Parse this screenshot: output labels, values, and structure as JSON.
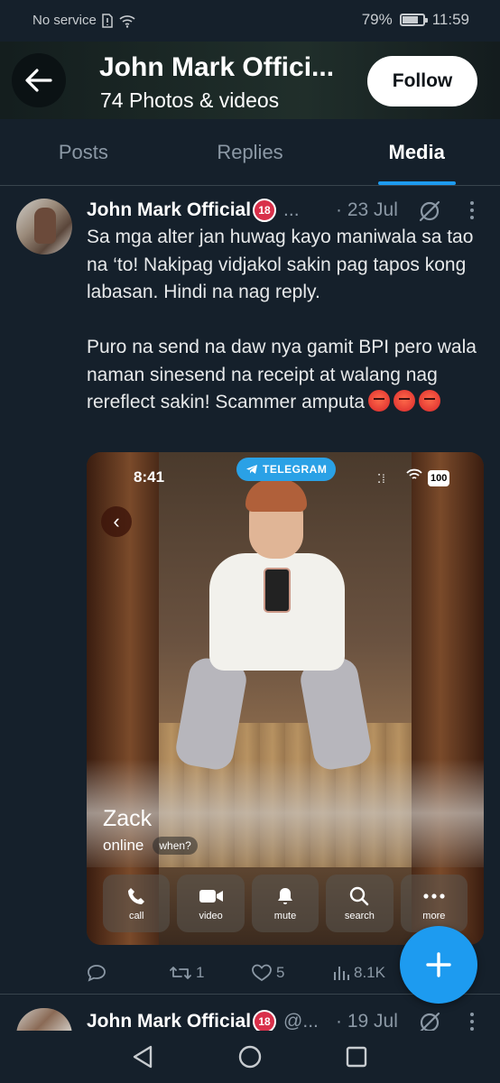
{
  "status_bar": {
    "carrier": "No service",
    "battery_pct": "79%",
    "time": "11:59",
    "battery_level": 0.79
  },
  "header": {
    "title": "John Mark Offici...",
    "subtitle": "74 Photos & videos",
    "follow_label": "Follow"
  },
  "tabs": [
    {
      "label": "Posts",
      "active": false
    },
    {
      "label": "Replies",
      "active": false
    },
    {
      "label": "Media",
      "active": true
    }
  ],
  "post": {
    "author": "John Mark Official",
    "age_badge": "18",
    "handle": "...",
    "date": "· 23 Jul",
    "text_p1": "Sa mga alter jan huwag kayo maniwala sa tao na ‘to! Nakipag vidjakol sakin pag tapos kong labasan. Hindi na nag reply.",
    "text_p2": "Puro na send na daw nya gamit BPI pero wala naman sinesend na receipt at walang nag rereflect sakin! Scammer amputa",
    "media": {
      "time": "8:41",
      "app_badge": "TELEGRAM",
      "battery": "100",
      "contact_name": "Zack",
      "contact_status": "online",
      "when_label": "when?",
      "actions": [
        {
          "icon": "phone-icon",
          "label": "call"
        },
        {
          "icon": "video-icon",
          "label": "video"
        },
        {
          "icon": "bell-icon",
          "label": "mute"
        },
        {
          "icon": "search-icon",
          "label": "search"
        },
        {
          "icon": "more-dots-icon",
          "label": "more"
        }
      ]
    },
    "engagement": {
      "reposts": "1",
      "likes": "5",
      "views": "8.1K"
    }
  },
  "post2": {
    "author": "John Mark Official",
    "age_badge": "18",
    "handle": "@...",
    "date": "· 19 Jul"
  },
  "colors": {
    "background": "#15202b",
    "accent": "#1d9bf0",
    "secondary_text": "#8b98a5",
    "telegram_blue": "#2aa1e6"
  }
}
